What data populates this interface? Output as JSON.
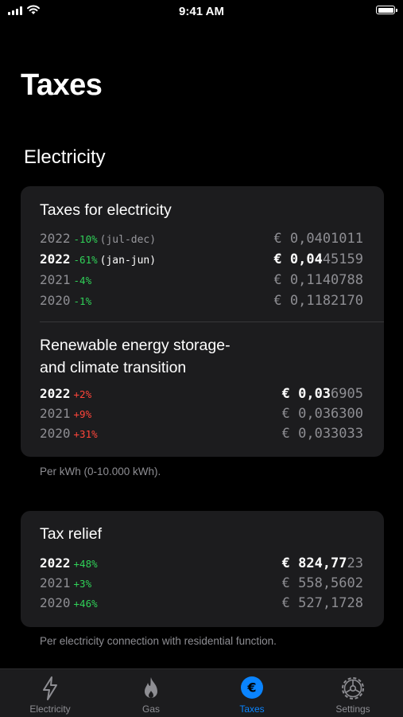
{
  "status_bar": {
    "time": "9:41 AM"
  },
  "page_title": "Taxes",
  "section_title": "Electricity",
  "electricity_card": {
    "title": "Taxes for electricity",
    "rows": [
      {
        "year": "2022",
        "change": "-10%",
        "note": "(jul-dec)",
        "value_main": "€ 0,0401011",
        "value_dim": "",
        "highlight": false
      },
      {
        "year": "2022",
        "change": "-61%",
        "note": "(jan-jun)",
        "value_main": "€ 0,04",
        "value_dim": "45159",
        "highlight": true
      },
      {
        "year": "2021",
        "change": "-4%",
        "note": "",
        "value_main": "€ 0,1140788",
        "value_dim": "",
        "highlight": false
      },
      {
        "year": "2020",
        "change": "-1%",
        "note": "",
        "value_main": "€ 0,1182170",
        "value_dim": "",
        "highlight": false
      }
    ],
    "renewable_title_line1": "Renewable energy storage-",
    "renewable_title_line2": "and climate transition",
    "renewable_rows": [
      {
        "year": "2022",
        "change": "+2%",
        "value_main": "€ 0,03",
        "value_dim": "6905",
        "highlight": true
      },
      {
        "year": "2021",
        "change": "+9%",
        "value_main": "€ 0,036300",
        "value_dim": "",
        "highlight": false
      },
      {
        "year": "2020",
        "change": "+31%",
        "value_main": "€ 0,033033",
        "value_dim": "",
        "highlight": false
      }
    ]
  },
  "electricity_footnote": "Per kWh (0-10.000 kWh).",
  "relief_card": {
    "title": "Tax relief",
    "rows": [
      {
        "year": "2022",
        "change": "+48%",
        "value_main": "€ 824,77",
        "value_dim": "23",
        "highlight": true
      },
      {
        "year": "2021",
        "change": "+3%",
        "value_main": "€ 558,5602",
        "value_dim": "",
        "highlight": false
      },
      {
        "year": "2020",
        "change": "+46%",
        "value_main": "€ 527,1728",
        "value_dim": "",
        "highlight": false
      }
    ]
  },
  "relief_footnote": "Per electricity connection with residential function.",
  "tabs": [
    {
      "label": "Electricity",
      "icon": "bolt-icon"
    },
    {
      "label": "Gas",
      "icon": "flame-icon"
    },
    {
      "label": "Taxes",
      "icon": "euro-circle-icon",
      "active": true
    },
    {
      "label": "Settings",
      "icon": "gear-icon"
    }
  ],
  "colors": {
    "accent": "#0a84ff",
    "positive": "#30d158",
    "negative": "#ff453a",
    "card": "#1c1c1e"
  }
}
